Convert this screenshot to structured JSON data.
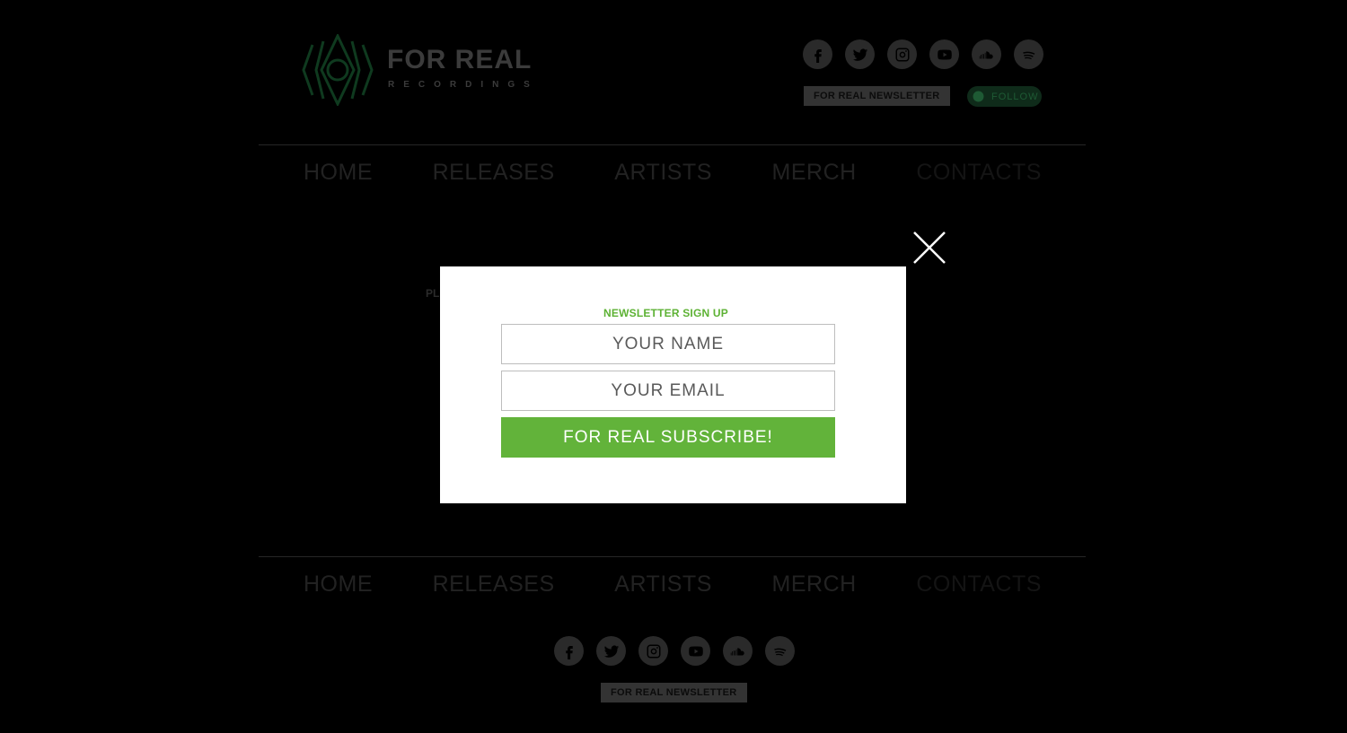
{
  "header": {
    "logo_title": "FOR REAL",
    "logo_subtitle": "RECORDINGS",
    "newsletter_label": "FOR REAL NEWSLETTER",
    "follow_label": "FOLLOW"
  },
  "social_icons": [
    "facebook-icon",
    "twitter-icon",
    "instagram-icon",
    "youtube-icon",
    "soundcloud-icon",
    "spotify-icon"
  ],
  "nav": {
    "home": "HOME",
    "releases": "RELEASES",
    "artists": "ARTISTS",
    "merch": "MERCH",
    "contacts": "CONTACTS"
  },
  "main": {
    "partial_text": "PL"
  },
  "modal": {
    "title": "NEWSLETTER SIGN UP",
    "name_placeholder": "YOUR NAME",
    "email_placeholder": "YOUR EMAIL",
    "submit_label": "FOR REAL SUBSCRIBE!"
  },
  "footer": {
    "newsletter_label": "FOR REAL NEWSLETTER"
  },
  "colors": {
    "accent_green": "#5db234",
    "button_green": "#62b33a",
    "overlay_background": "#000000"
  }
}
